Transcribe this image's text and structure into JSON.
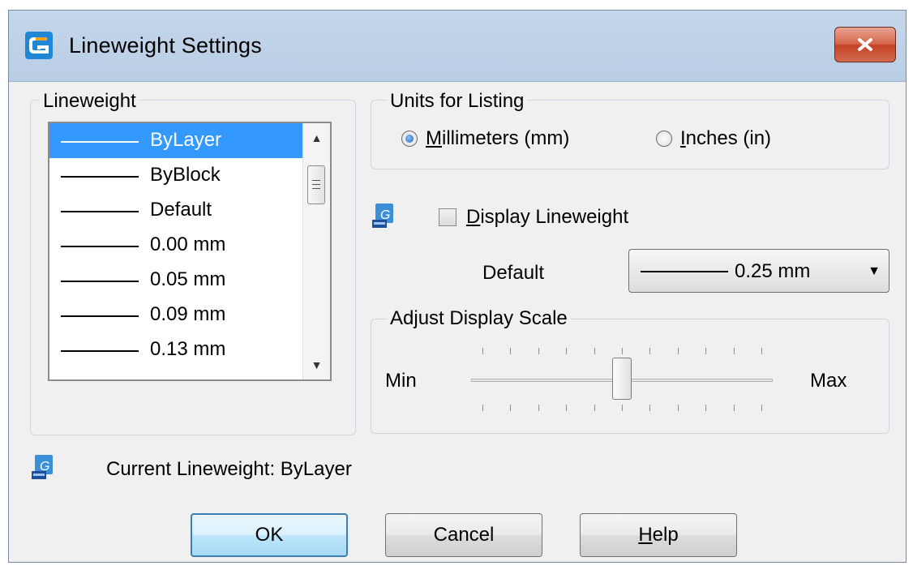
{
  "window": {
    "title": "Lineweight Settings",
    "close_label": "x"
  },
  "lineweight_group": {
    "label": "Lineweight",
    "items": [
      "ByLayer",
      "ByBlock",
      "Default",
      "0.00 mm",
      "0.05 mm",
      "0.09 mm",
      "0.13 mm"
    ],
    "selected_index": 0
  },
  "units_group": {
    "label": "Units for Listing",
    "millimeters": {
      "mnemonic": "M",
      "rest": "illimeters (mm)",
      "checked": true
    },
    "inches": {
      "mnemonic": "I",
      "rest": "nches (in)",
      "checked": false
    }
  },
  "display": {
    "checkbox_mnemonic": "D",
    "checkbox_rest": "isplay Lineweight",
    "checked": false,
    "default_label": "Default",
    "default_value": "0.25 mm"
  },
  "scale_group": {
    "label": "Adjust Display Scale",
    "min_label": "Min",
    "max_label": "Max",
    "value_fraction": 0.5
  },
  "status": {
    "current": "Current Lineweight: ByLayer"
  },
  "buttons": {
    "ok": "OK",
    "cancel": "Cancel",
    "help_mnemonic": "H",
    "help_rest": "elp"
  },
  "colors": {
    "selection": "#3399ff",
    "titlebar": "#b9cde4",
    "close_button": "#c9482c"
  },
  "icons": {
    "app": "app-logo-icon",
    "preview": "dwg-preview-icon",
    "close": "close-icon"
  }
}
